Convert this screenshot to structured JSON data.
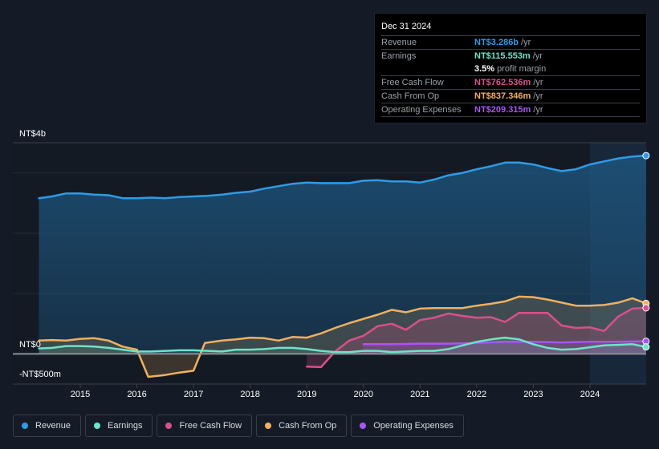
{
  "tooltip": {
    "date": "Dec 31 2024",
    "rows": [
      {
        "label": "Revenue",
        "value": "NT$3.286b",
        "unit": "/yr",
        "color": "#2f9be6"
      },
      {
        "label": "Earnings",
        "value": "NT$115.553m",
        "unit": "/yr",
        "color": "#6ee3c9"
      },
      {
        "label": "",
        "value": "3.5%",
        "unit": "profit margin",
        "color": "#ffffff"
      },
      {
        "label": "Free Cash Flow",
        "value": "NT$762.536m",
        "unit": "/yr",
        "color": "#d9508a"
      },
      {
        "label": "Cash From Op",
        "value": "NT$837.346m",
        "unit": "/yr",
        "color": "#f0b060"
      },
      {
        "label": "Operating Expenses",
        "value": "NT$209.315m",
        "unit": "/yr",
        "color": "#a855f7"
      }
    ]
  },
  "legend": [
    {
      "label": "Revenue",
      "color": "#2f9be6"
    },
    {
      "label": "Earnings",
      "color": "#6ee3c9"
    },
    {
      "label": "Free Cash Flow",
      "color": "#d9508a"
    },
    {
      "label": "Cash From Op",
      "color": "#f0b060"
    },
    {
      "label": "Operating Expenses",
      "color": "#a855f7"
    }
  ],
  "chart_data": {
    "type": "area",
    "title": "",
    "xlabel": "",
    "ylabel": "",
    "y_unit": "NT$ billions",
    "ylim": [
      -0.5,
      3.5
    ],
    "xlim": [
      2014.0,
      2025.0
    ],
    "y_axis_labels": [
      {
        "value": 3.5,
        "text": "NT$4b"
      },
      {
        "value": 0,
        "text": "NT$0"
      },
      {
        "value": -0.5,
        "text": "-NT$500m"
      }
    ],
    "x_ticks": [
      2015,
      2016,
      2017,
      2018,
      2019,
      2020,
      2021,
      2022,
      2023,
      2024
    ],
    "x_tick_labels": [
      "2015",
      "2016",
      "2017",
      "2018",
      "2019",
      "2020",
      "2021",
      "2022",
      "2023",
      "2024"
    ],
    "gridlines": [
      3,
      2,
      1
    ],
    "highlight_from": 2024.0,
    "series": [
      {
        "name": "Revenue",
        "color": "#2f9be6",
        "x": [
          2014.27,
          2014.5,
          2014.75,
          2015.0,
          2015.25,
          2015.5,
          2015.75,
          2016.0,
          2016.25,
          2016.5,
          2016.75,
          2017.0,
          2017.25,
          2017.5,
          2017.75,
          2018.0,
          2018.25,
          2018.5,
          2018.75,
          2019.0,
          2019.25,
          2019.5,
          2019.75,
          2020.0,
          2020.25,
          2020.5,
          2020.75,
          2021.0,
          2021.25,
          2021.5,
          2021.75,
          2022.0,
          2022.25,
          2022.5,
          2022.75,
          2023.0,
          2023.25,
          2023.5,
          2023.75,
          2024.0,
          2024.25,
          2024.5,
          2024.75,
          2024.99
        ],
        "values": [
          2.58,
          2.61,
          2.66,
          2.66,
          2.64,
          2.63,
          2.58,
          2.58,
          2.59,
          2.58,
          2.6,
          2.61,
          2.62,
          2.64,
          2.67,
          2.69,
          2.74,
          2.78,
          2.82,
          2.84,
          2.83,
          2.83,
          2.83,
          2.87,
          2.88,
          2.86,
          2.86,
          2.84,
          2.89,
          2.96,
          3.0,
          3.06,
          3.11,
          3.17,
          3.17,
          3.14,
          3.08,
          3.03,
          3.06,
          3.14,
          3.19,
          3.24,
          3.27,
          3.286
        ]
      },
      {
        "name": "Earnings",
        "color": "#6ee3c9",
        "x": [
          2014.27,
          2014.5,
          2014.75,
          2015.0,
          2015.25,
          2015.5,
          2015.75,
          2016.0,
          2016.25,
          2016.5,
          2016.75,
          2017.0,
          2017.25,
          2017.5,
          2017.75,
          2018.0,
          2018.25,
          2018.5,
          2018.75,
          2019.0,
          2019.25,
          2019.5,
          2019.75,
          2020.0,
          2020.25,
          2020.5,
          2020.75,
          2021.0,
          2021.25,
          2021.5,
          2021.75,
          2022.0,
          2022.25,
          2022.5,
          2022.75,
          2023.0,
          2023.25,
          2023.5,
          2023.75,
          2024.0,
          2024.25,
          2024.5,
          2024.75,
          2024.99
        ],
        "values": [
          0.09,
          0.1,
          0.13,
          0.13,
          0.12,
          0.1,
          0.07,
          0.04,
          0.04,
          0.05,
          0.06,
          0.06,
          0.05,
          0.04,
          0.07,
          0.07,
          0.08,
          0.1,
          0.1,
          0.08,
          0.05,
          0.03,
          0.03,
          0.05,
          0.05,
          0.03,
          0.04,
          0.05,
          0.05,
          0.08,
          0.14,
          0.2,
          0.24,
          0.27,
          0.24,
          0.16,
          0.1,
          0.07,
          0.08,
          0.11,
          0.14,
          0.15,
          0.16,
          0.116
        ]
      },
      {
        "name": "Free Cash Flow",
        "color": "#d9508a",
        "x": [
          2019.0,
          2019.25,
          2019.5,
          2019.75,
          2020.0,
          2020.25,
          2020.5,
          2020.75,
          2021.0,
          2021.25,
          2021.5,
          2021.75,
          2022.0,
          2022.25,
          2022.5,
          2022.75,
          2023.0,
          2023.25,
          2023.5,
          2023.75,
          2024.0,
          2024.25,
          2024.5,
          2024.75,
          2024.99
        ],
        "values": [
          -0.21,
          -0.22,
          0.04,
          0.22,
          0.3,
          0.46,
          0.5,
          0.4,
          0.56,
          0.6,
          0.67,
          0.63,
          0.6,
          0.61,
          0.53,
          0.68,
          0.68,
          0.68,
          0.47,
          0.43,
          0.44,
          0.38,
          0.62,
          0.75,
          0.763
        ]
      },
      {
        "name": "Cash From Op",
        "color": "#f0b060",
        "x": [
          2014.27,
          2014.5,
          2014.75,
          2015.0,
          2015.25,
          2015.5,
          2015.75,
          2016.0,
          2016.2,
          2016.5,
          2016.75,
          2017.0,
          2017.2,
          2017.5,
          2017.75,
          2018.0,
          2018.25,
          2018.5,
          2018.75,
          2019.0,
          2019.25,
          2019.5,
          2019.75,
          2020.0,
          2020.25,
          2020.5,
          2020.75,
          2021.0,
          2021.25,
          2021.5,
          2021.75,
          2022.0,
          2022.25,
          2022.5,
          2022.75,
          2023.0,
          2023.25,
          2023.5,
          2023.75,
          2024.0,
          2024.25,
          2024.5,
          2024.75,
          2024.99
        ],
        "values": [
          0.22,
          0.23,
          0.22,
          0.25,
          0.26,
          0.22,
          0.12,
          0.07,
          -0.38,
          -0.35,
          -0.31,
          -0.28,
          0.18,
          0.22,
          0.24,
          0.27,
          0.26,
          0.22,
          0.28,
          0.27,
          0.34,
          0.43,
          0.51,
          0.58,
          0.65,
          0.73,
          0.69,
          0.75,
          0.76,
          0.76,
          0.76,
          0.8,
          0.83,
          0.87,
          0.95,
          0.94,
          0.9,
          0.85,
          0.8,
          0.8,
          0.81,
          0.85,
          0.92,
          0.837
        ]
      },
      {
        "name": "Operating Expenses",
        "color": "#a855f7",
        "x": [
          2020.0,
          2020.5,
          2021.0,
          2021.5,
          2022.0,
          2022.5,
          2023.0,
          2023.5,
          2024.0,
          2024.5,
          2024.99
        ],
        "values": [
          0.16,
          0.16,
          0.17,
          0.17,
          0.18,
          0.2,
          0.2,
          0.19,
          0.2,
          0.2,
          0.209
        ]
      }
    ]
  }
}
